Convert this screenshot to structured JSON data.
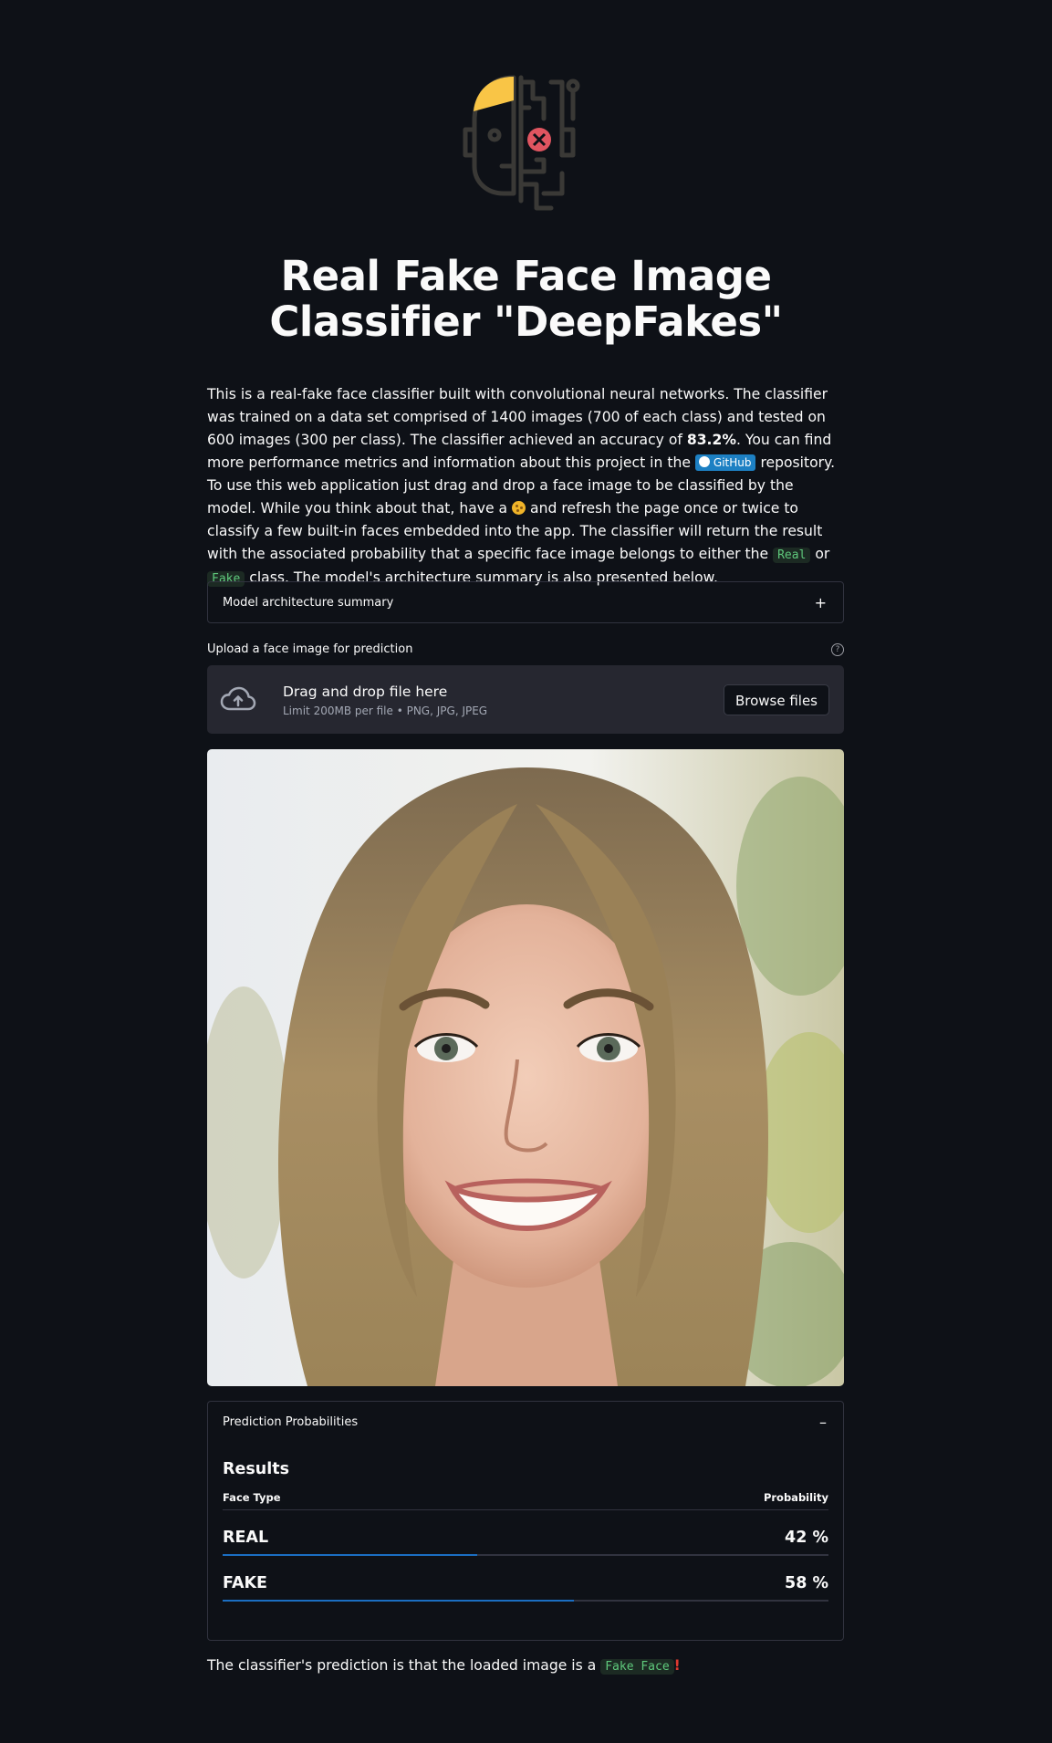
{
  "page": {
    "title": "Real Fake Face Image Classifier \"DeepFakes\""
  },
  "intro": {
    "p1": "This is a real-fake face classifier built with convolutional neural networks. The classifier was trained on a data set comprised of 1400 images (700 of each class) and tested on 600 images (300 per class). The classifier achieved an accuracy of ",
    "accuracy": "83.2%",
    "p2": ". You can find more performance metrics and information about this project in the ",
    "github_badge": "GitHub",
    "p3": " repository. To use this web application just drag and drop a face image to be classified by the model. While you think about that, have a ",
    "p4": " and refresh the page once or twice to classify a few built-in faces embedded into the app. The classifier will return the result with the associated probability that a specific face image belongs to either the ",
    "class_real": "Real",
    "or": " or ",
    "class_fake": "Fake",
    "p5": " class. The model's architecture summary is also presented below."
  },
  "architecture_expander": {
    "label": "Model architecture summary",
    "sign": "+"
  },
  "uploader": {
    "label": "Upload a face image for prediction",
    "help": "?",
    "drop_text": "Drag and drop file here",
    "limit_text": "Limit 200MB per file • PNG, JPG, JPEG",
    "browse_label": "Browse files"
  },
  "prediction_expander": {
    "label": "Prediction Probabilities",
    "sign": "–",
    "results_title": "Results",
    "col_face_type": "Face Type",
    "col_probability": "Probability",
    "rows": [
      {
        "type": "REAL",
        "prob_text": "42 %",
        "prob": 0.42
      },
      {
        "type": "FAKE",
        "prob_text": "58 %",
        "prob": 0.58
      }
    ]
  },
  "verdict": {
    "text": "The classifier's prediction is that the loaded image is a ",
    "label": "Fake Face",
    "bang": "!"
  },
  "colors": {
    "background": "#0e1117",
    "accent_blue": "#1b6ec2",
    "logo_yellow": "#f9c546",
    "logo_red": "#e05560"
  }
}
